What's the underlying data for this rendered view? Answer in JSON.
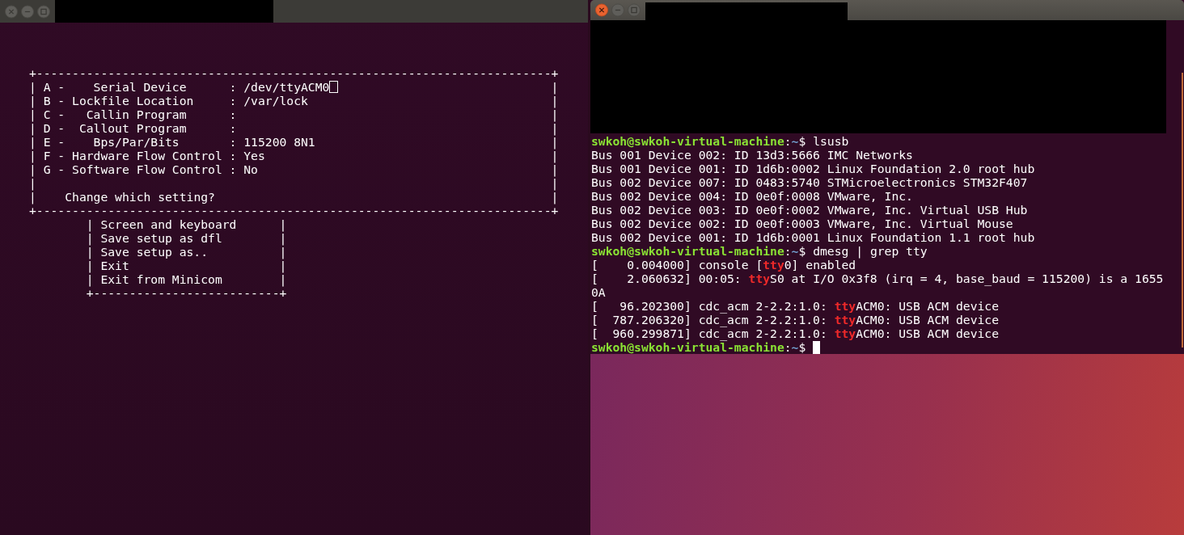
{
  "windows": [
    {
      "kind": "minicom",
      "active": false,
      "config_lines": [
        {
          "text": "+------------------------------------------------------------------------+",
          "cursor": false
        },
        {
          "text": "| A -    Serial Device      : /dev/ttyACM0",
          "cursor": true,
          "end": "|"
        },
        {
          "text": "| B - Lockfile Location     : /var/lock",
          "cursor": false,
          "end": "|"
        },
        {
          "text": "| C -   Callin Program      :",
          "cursor": false,
          "end": "|"
        },
        {
          "text": "| D -  Callout Program      :",
          "cursor": false,
          "end": "|"
        },
        {
          "text": "| E -    Bps/Par/Bits       : 115200 8N1",
          "cursor": false,
          "end": "|"
        },
        {
          "text": "| F - Hardware Flow Control : Yes",
          "cursor": false,
          "end": "|"
        },
        {
          "text": "| G - Software Flow Control : No",
          "cursor": false,
          "end": "|"
        },
        {
          "text": "|",
          "cursor": false,
          "end": "|"
        },
        {
          "text": "|    Change which setting?",
          "cursor": false,
          "end": "|"
        },
        {
          "text": "+------------------------------------------------------------------------+",
          "cursor": false
        }
      ],
      "menu_lines": [
        {
          "text": "| Screen and keyboard",
          "end": "|"
        },
        {
          "text": "| Save setup as dfl",
          "end": "|"
        },
        {
          "text": "| Save setup as..",
          "end": "|"
        },
        {
          "text": "| Exit",
          "end": "|"
        },
        {
          "text": "| Exit from Minicom",
          "end": "|"
        },
        {
          "text": "+--------------------------+"
        }
      ]
    },
    {
      "kind": "terminal",
      "active": true,
      "lines": [
        {
          "cursor": false,
          "segments": [
            {
              "kind": "user",
              "text": "swkoh@swkoh-virtual-machine"
            },
            {
              "kind": "plain",
              "text": ":"
            },
            {
              "kind": "path",
              "text": "~"
            },
            {
              "kind": "plain",
              "text": "$ lsusb"
            }
          ]
        },
        {
          "cursor": false,
          "segments": [
            {
              "kind": "plain",
              "text": "Bus 001 Device 002: ID 13d3:5666 IMC Networks"
            }
          ]
        },
        {
          "cursor": false,
          "segments": [
            {
              "kind": "plain",
              "text": "Bus 001 Device 001: ID 1d6b:0002 Linux Foundation 2.0 root hub"
            }
          ]
        },
        {
          "cursor": false,
          "segments": [
            {
              "kind": "plain",
              "text": "Bus 002 Device 007: ID 0483:5740 STMicroelectronics STM32F407"
            }
          ]
        },
        {
          "cursor": false,
          "segments": [
            {
              "kind": "plain",
              "text": "Bus 002 Device 004: ID 0e0f:0008 VMware, Inc."
            }
          ]
        },
        {
          "cursor": false,
          "segments": [
            {
              "kind": "plain",
              "text": "Bus 002 Device 003: ID 0e0f:0002 VMware, Inc. Virtual USB Hub"
            }
          ]
        },
        {
          "cursor": false,
          "segments": [
            {
              "kind": "plain",
              "text": "Bus 002 Device 002: ID 0e0f:0003 VMware, Inc. Virtual Mouse"
            }
          ]
        },
        {
          "cursor": false,
          "segments": [
            {
              "kind": "plain",
              "text": "Bus 002 Device 001: ID 1d6b:0001 Linux Foundation 1.1 root hub"
            }
          ]
        },
        {
          "cursor": false,
          "segments": [
            {
              "kind": "user",
              "text": "swkoh@swkoh-virtual-machine"
            },
            {
              "kind": "plain",
              "text": ":"
            },
            {
              "kind": "path",
              "text": "~"
            },
            {
              "kind": "plain",
              "text": "$ dmesg | grep tty"
            }
          ]
        },
        {
          "cursor": false,
          "segments": [
            {
              "kind": "plain",
              "text": "[    0.004000] console ["
            },
            {
              "kind": "match",
              "text": "tty"
            },
            {
              "kind": "plain",
              "text": "0] enabled"
            }
          ]
        },
        {
          "cursor": false,
          "segments": [
            {
              "kind": "plain",
              "text": "[    2.060632] 00:05: "
            },
            {
              "kind": "match",
              "text": "tty"
            },
            {
              "kind": "plain",
              "text": "S0 at I/O 0x3f8 (irq = 4, base_baud = 115200) is a 1655"
            }
          ]
        },
        {
          "cursor": false,
          "segments": [
            {
              "kind": "plain",
              "text": "0A"
            }
          ]
        },
        {
          "cursor": false,
          "segments": [
            {
              "kind": "plain",
              "text": "[   96.202300] cdc_acm 2-2.2:1.0: "
            },
            {
              "kind": "match",
              "text": "tty"
            },
            {
              "kind": "plain",
              "text": "ACM0: USB ACM device"
            }
          ]
        },
        {
          "cursor": false,
          "segments": [
            {
              "kind": "plain",
              "text": "[  787.206320] cdc_acm 2-2.2:1.0: "
            },
            {
              "kind": "match",
              "text": "tty"
            },
            {
              "kind": "plain",
              "text": "ACM0: USB ACM device"
            }
          ]
        },
        {
          "cursor": false,
          "segments": [
            {
              "kind": "plain",
              "text": "[  960.299871] cdc_acm 2-2.2:1.0: "
            },
            {
              "kind": "match",
              "text": "tty"
            },
            {
              "kind": "plain",
              "text": "ACM0: USB ACM device"
            }
          ]
        },
        {
          "cursor": true,
          "segments": [
            {
              "kind": "user",
              "text": "swkoh@swkoh-virtual-machine"
            },
            {
              "kind": "plain",
              "text": ":"
            },
            {
              "kind": "path",
              "text": "~"
            },
            {
              "kind": "plain",
              "text": "$ "
            }
          ]
        }
      ]
    }
  ]
}
